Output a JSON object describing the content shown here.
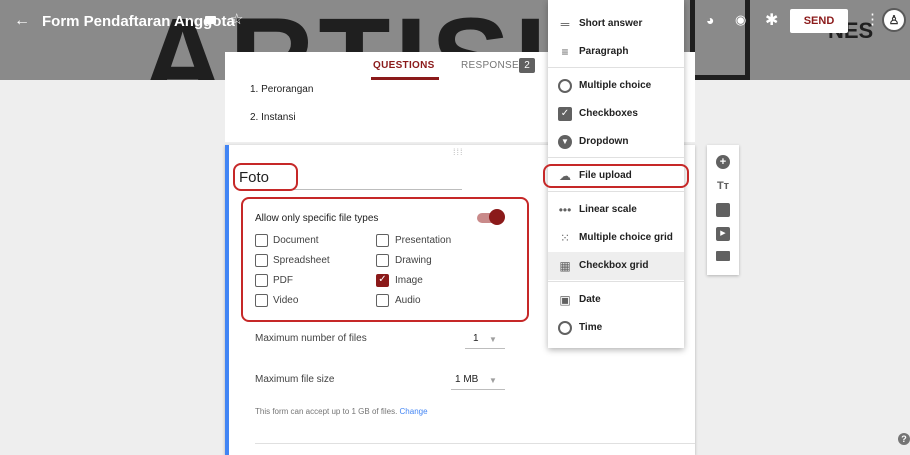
{
  "header": {
    "title": "Form Pendaftaran Anggota",
    "send_label": "SEND",
    "background_text": "ARTISI",
    "background_vertical_text": "NES"
  },
  "tabs": {
    "questions": "QUESTIONS",
    "responses": "RESPONSES",
    "responses_count": "2"
  },
  "prev_question": {
    "options": [
      "1.  Perorangan",
      "2.  Instansi"
    ]
  },
  "question": {
    "title": "Foto",
    "allow_specific_label": "Allow only specific file types",
    "allow_specific_enabled": true,
    "file_types": [
      {
        "label": "Document",
        "checked": false
      },
      {
        "label": "Presentation",
        "checked": false
      },
      {
        "label": "Spreadsheet",
        "checked": false
      },
      {
        "label": "Drawing",
        "checked": false
      },
      {
        "label": "PDF",
        "checked": false
      },
      {
        "label": "Image",
        "checked": true
      },
      {
        "label": "Video",
        "checked": false
      },
      {
        "label": "Audio",
        "checked": false
      }
    ],
    "max_files_label": "Maximum number of files",
    "max_files_value": "1",
    "max_size_label": "Maximum file size",
    "max_size_value": "1 MB",
    "note": "This form can accept up to 1 GB of files.",
    "note_link": "Change"
  },
  "menu": {
    "items": [
      {
        "label": "Short answer",
        "icon": "short-answer-icon"
      },
      {
        "label": "Paragraph",
        "icon": "paragraph-icon"
      },
      {
        "label": "Multiple choice",
        "icon": "radio-icon"
      },
      {
        "label": "Checkboxes",
        "icon": "checkbox-icon"
      },
      {
        "label": "Dropdown",
        "icon": "dropdown-icon"
      },
      {
        "label": "File upload",
        "icon": "cloud-upload-icon"
      },
      {
        "label": "Linear scale",
        "icon": "linear-scale-icon"
      },
      {
        "label": "Multiple choice grid",
        "icon": "grid-icon"
      },
      {
        "label": "Checkbox grid",
        "icon": "grid-icon"
      },
      {
        "label": "Date",
        "icon": "calendar-icon"
      },
      {
        "label": "Time",
        "icon": "clock-icon"
      }
    ]
  },
  "colors": {
    "header_bg": "#8a8a8a",
    "accent": "#8b1a1a",
    "highlight_outline": "#c62828",
    "card_accent": "#4285f4"
  }
}
